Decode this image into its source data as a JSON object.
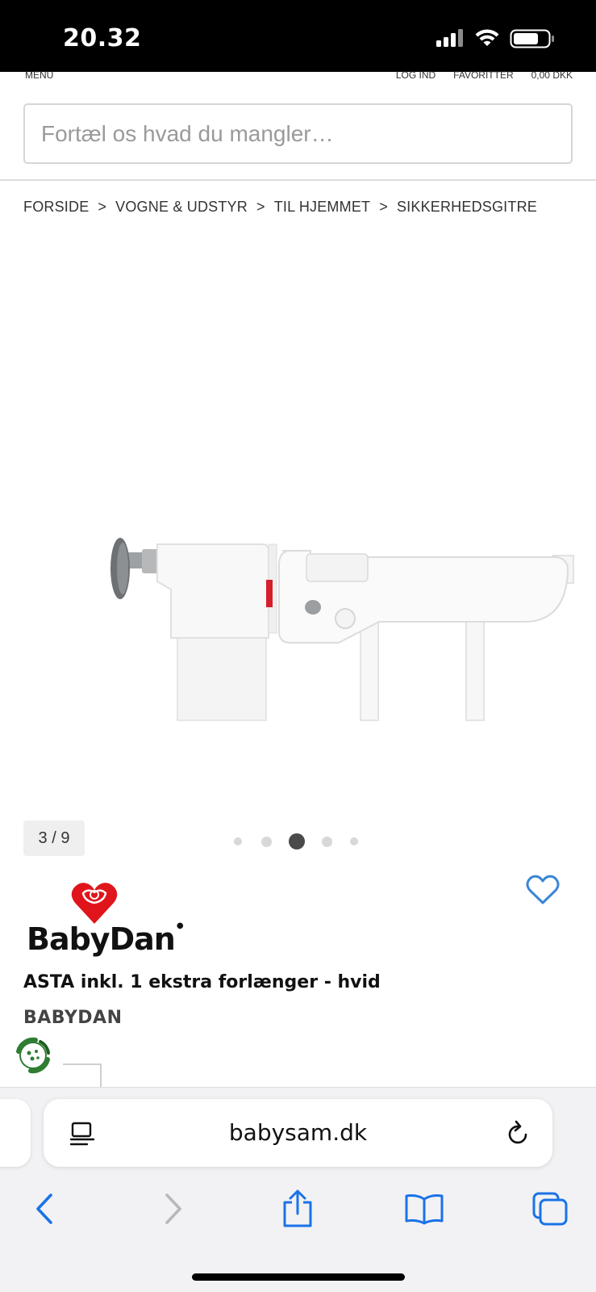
{
  "status_bar": {
    "time": "20.32"
  },
  "topnav": {
    "menu": "MENU",
    "login": "LOG IND",
    "favorites": "FAVORITTER",
    "cart_total": "0,00 DKK"
  },
  "search": {
    "placeholder": "Fortæl os hvad du mangler…"
  },
  "breadcrumb": {
    "items": [
      "FORSIDE",
      "VOGNE & UDSTYR",
      "TIL HJEMMET",
      "SIKKERHEDSGITRE"
    ],
    "separator": ">"
  },
  "gallery": {
    "counter": "3 / 9",
    "dot_count": 5,
    "active_index": 2
  },
  "product": {
    "brand_logo_text": "BabyDan",
    "title": "ASTA inkl. 1 ekstra forlænger - hvid",
    "brand": "BABYDAN"
  },
  "browser": {
    "url": "babysam.dk"
  },
  "colors": {
    "accent_blue": "#1a73e8",
    "heart_blue": "#3a86d4",
    "logo_red": "#e0151b",
    "eco_green": "#2e7d32"
  },
  "icons": {
    "reader": "reader-icon",
    "reload": "reload-icon",
    "back": "chevron-left-icon",
    "forward": "chevron-right-icon",
    "share": "share-icon",
    "bookmarks": "book-icon",
    "tabs": "tabs-icon",
    "favorite": "heart-icon"
  }
}
